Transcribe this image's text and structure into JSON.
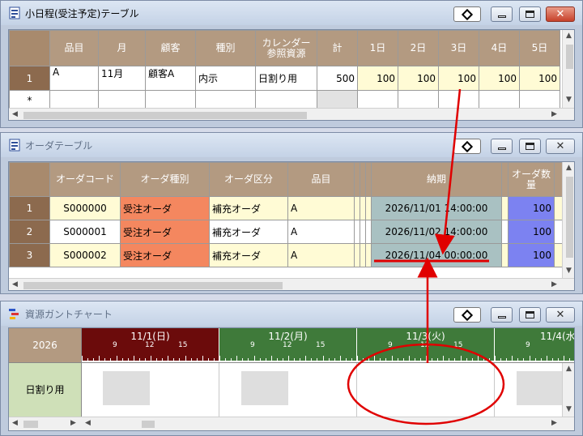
{
  "windows": {
    "schedule": {
      "title": "小日程(受注予定)テーブル",
      "headers": [
        "品目",
        "月",
        "顧客",
        "種別",
        "カレンダー参照資源",
        "計",
        "1日",
        "2日",
        "3日",
        "4日",
        "5日"
      ],
      "rows": [
        {
          "index": "1",
          "item": "A",
          "month": "11月",
          "customer": "顧客A",
          "kind": "内示",
          "calendar": "日割り用",
          "total": "500",
          "d1": "100",
          "d2": "100",
          "d3": "100",
          "d4": "100",
          "d5": "100"
        }
      ],
      "new_row_marker": "*"
    },
    "orders": {
      "title": "オーダテーブル",
      "headers": [
        "オーダコード",
        "オーダ種別",
        "オーダ区分",
        "品目",
        "納期",
        "オーダ数量"
      ],
      "rows": [
        {
          "index": "1",
          "code": "S000000",
          "type": "受注オーダ",
          "category": "補充オーダ",
          "item": "A",
          "due": "2026/11/01 14:00:00",
          "qty": "100"
        },
        {
          "index": "2",
          "code": "S000001",
          "type": "受注オーダ",
          "category": "補充オーダ",
          "item": "A",
          "due": "2026/11/02 14:00:00",
          "qty": "100"
        },
        {
          "index": "3",
          "code": "S000002",
          "type": "受注オーダ",
          "category": "補充オーダ",
          "item": "A",
          "due": "2026/11/04 00:00:00",
          "qty": "100"
        }
      ]
    },
    "gantt": {
      "title": "資源ガントチャート",
      "year": "2026",
      "resource": "日割り用",
      "days": [
        {
          "label": "11/1(日)",
          "color": "#6b0b0b",
          "ticks": [
            "9",
            "12",
            "15"
          ]
        },
        {
          "label": "11/2(月)",
          "color": "#3f7a3a",
          "ticks": [
            "9",
            "12",
            "15"
          ]
        },
        {
          "label": "11/3(火)",
          "color": "#3f7a3a",
          "ticks": [
            "9",
            "12",
            "15"
          ]
        },
        {
          "label": "11/4(水",
          "color": "#3f7a3a",
          "ticks": [
            "9"
          ]
        }
      ]
    }
  },
  "colors": {
    "header_brown": "#b39a81",
    "row_header": "#8c6a4e",
    "order_type": "#f4875f",
    "due_cell": "#a9c1c2",
    "qty_cell": "#7c82f1",
    "annotation_red": "#e00000"
  },
  "icons": {
    "pin": "diamond-pin-icon",
    "minimize": "minimize-icon",
    "maximize": "maximize-icon",
    "close": "close-icon"
  }
}
